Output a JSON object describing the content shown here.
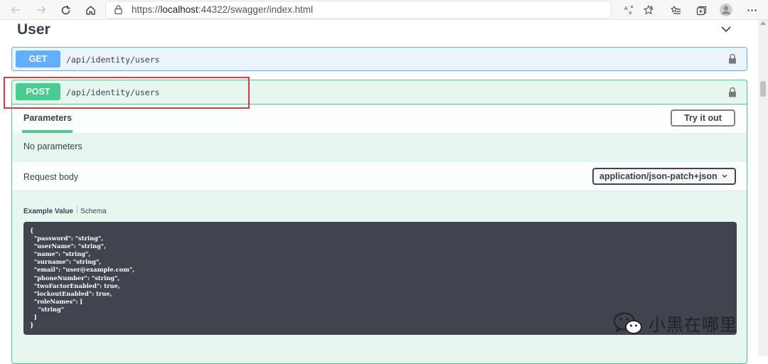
{
  "browser": {
    "url_scheme": "https://",
    "url_host": "localhost",
    "url_rest": ":44322/swagger/index.html",
    "icons": [
      "back-icon",
      "forward-icon",
      "refresh-icon",
      "home-icon",
      "lock-icon",
      "read-aloud-icon",
      "favorite-icon",
      "favorites-list-icon",
      "collections-icon",
      "profile-icon",
      "more-icon"
    ]
  },
  "section": {
    "title": "User"
  },
  "operations": {
    "get": {
      "method": "GET",
      "path": "/api/identity/users"
    },
    "post": {
      "method": "POST",
      "path": "/api/identity/users"
    }
  },
  "parameters": {
    "tab_label": "Parameters",
    "try_label": "Try it out",
    "empty_text": "No parameters"
  },
  "request_body": {
    "label": "Request body",
    "content_type": "application/json-patch+json"
  },
  "example": {
    "active_tab": "Example Value",
    "other_tab": "Schema",
    "code_lines": [
      "{",
      "  \"password\": \"string\",",
      "  \"userName\": \"string\",",
      "  \"name\": \"string\",",
      "  \"surname\": \"string\",",
      "  \"email\": \"user@example.com\",",
      "  \"phoneNumber\": \"string\",",
      "  \"twoFactorEnabled\": true,",
      "  \"lockoutEnabled\": true,",
      "  \"roleNames\": [",
      "    \"string\"",
      "  ]",
      "}"
    ]
  },
  "watermark": {
    "text": "小黑在哪里"
  },
  "colors": {
    "get": "#61affe",
    "post": "#49cc90",
    "highlight": "#e23a3a",
    "code_bg": "#41444e"
  }
}
